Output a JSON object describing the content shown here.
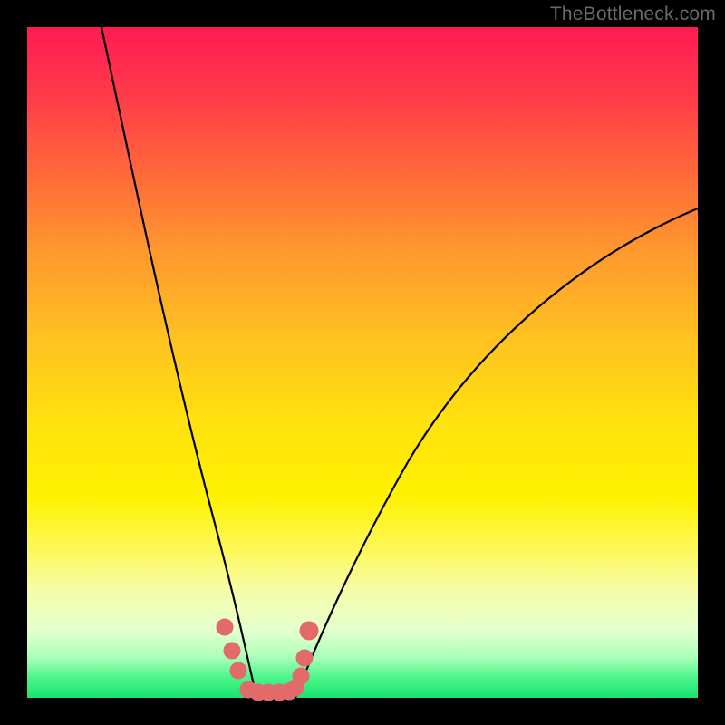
{
  "watermark": "TheBottleneck.com",
  "chart_data": {
    "type": "line",
    "title": "",
    "xlabel": "",
    "ylabel": "",
    "xlim": [
      0,
      100
    ],
    "ylim": [
      0,
      100
    ],
    "background_gradient": {
      "top_color": "#ff1a55",
      "mid_color": "#fff200",
      "bottom_color": "#18e46e"
    },
    "series": [
      {
        "name": "left-curve",
        "x": [
          11,
          15,
          20,
          25,
          28,
          30,
          32,
          33,
          34
        ],
        "y": [
          100,
          78,
          55,
          33,
          20,
          11,
          5,
          2,
          0
        ]
      },
      {
        "name": "right-curve",
        "x": [
          40,
          42,
          45,
          50,
          55,
          62,
          70,
          80,
          90,
          100
        ],
        "y": [
          0,
          4,
          10,
          20,
          29,
          40,
          50,
          60,
          67,
          73
        ]
      }
    ],
    "markers": {
      "name": "trough-dots",
      "color": "#e26a6a",
      "shape": "circle",
      "x": [
        29.5,
        30.5,
        31.5,
        33,
        34.5,
        36,
        37.5,
        39,
        40,
        40.8,
        41.3,
        42
      ],
      "y": [
        10.5,
        7,
        4,
        1.2,
        0.8,
        0.8,
        0.8,
        1.0,
        1.5,
        3.2,
        6,
        10
      ]
    }
  }
}
